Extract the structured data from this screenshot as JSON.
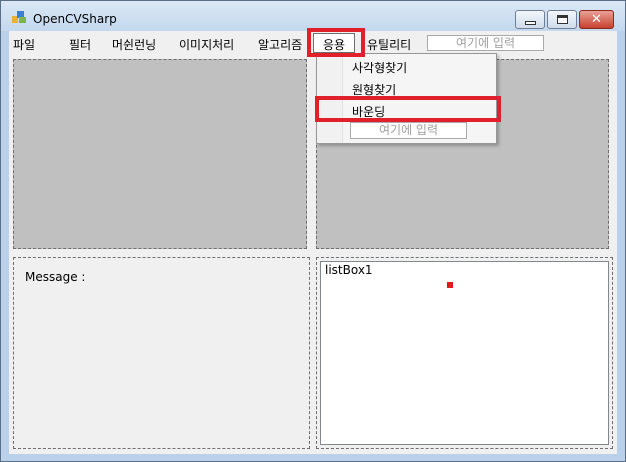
{
  "window": {
    "title": "OpenCVSharp"
  },
  "menu": {
    "items": [
      "파일",
      "필터",
      "머쉰런닝",
      "이미지처리",
      "알고리즘",
      "응용",
      "유틸리티"
    ],
    "input_placeholder": "여기에 입력"
  },
  "dropdown": {
    "items": [
      "사각형찾기",
      "원형찾기",
      "바운딩"
    ],
    "input_placeholder": "여기에 입력"
  },
  "message": {
    "label": "Message :"
  },
  "listbox": {
    "text": "listBox1"
  },
  "colors": {
    "highlight": "#e0202a",
    "picture_bg": "#c0c0c0"
  }
}
